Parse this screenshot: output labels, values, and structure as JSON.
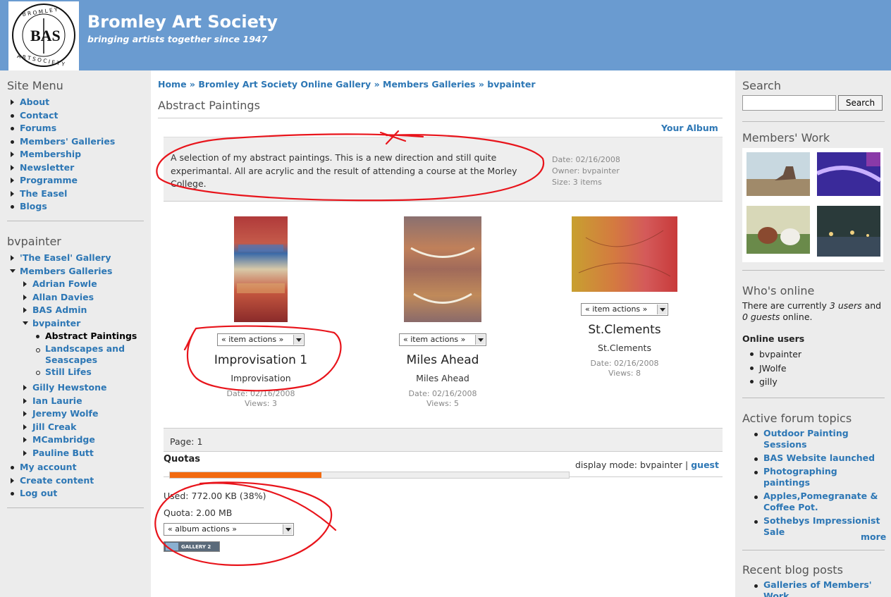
{
  "header": {
    "logo_text": "BAS",
    "logo_ring_text": "BROMLEY ART SOCIETY",
    "site_name": "Bromley Art Society",
    "slogan": "bringing artists together since 1947"
  },
  "site_menu": {
    "title": "Site Menu",
    "items": [
      "About",
      "Contact",
      "Forums",
      "Members' Galleries",
      "Membership",
      "Newsletter",
      "Programme",
      "The Easel",
      "Blogs"
    ]
  },
  "user_menu": {
    "title": "bvpainter",
    "easel_gallery": "'The Easel' Gallery",
    "members_galleries": "Members Galleries",
    "members": [
      "Adrian Fowle",
      "Allan Davies",
      "BAS Admin"
    ],
    "bvpainter": "bvpainter",
    "bvpainter_albums": [
      "Abstract Paintings",
      "Landscapes and",
      "Seascapes",
      "Still Lifes"
    ],
    "members_after": [
      "Gilly Hewstone",
      "Ian Laurie",
      "Jeremy Wolfe",
      "Jill Creak",
      "MCambridge",
      "Pauline Butt"
    ],
    "my_account": "My account",
    "create_content": "Create content",
    "log_out": "Log out"
  },
  "breadcrumb": [
    "Home",
    "Bromley Art Society Online Gallery",
    "Members Galleries",
    "bvpainter"
  ],
  "breadcrumb_sep": "»",
  "page_title": "Abstract Paintings",
  "your_album": "Your Album",
  "album": {
    "description": "A selection of my abstract paintings. This is a new direction and still quite experimantal. All are acrylic and the result of attending a course at the Morley College.",
    "date": "Date: 02/16/2008",
    "owner": "Owner: bvpainter",
    "size": "Size: 3 items"
  },
  "items": [
    {
      "title": "Improvisation 1",
      "summary": "Improvisation",
      "date": "Date: 02/16/2008",
      "views": "Views: 3",
      "actions": "« item actions »"
    },
    {
      "title": "Miles Ahead",
      "summary": "Miles Ahead",
      "date": "Date: 02/16/2008",
      "views": "Views: 5",
      "actions": "« item actions »"
    },
    {
      "title": "St.Clements",
      "summary": "St.Clements",
      "date": "Date: 02/16/2008",
      "views": "Views: 8",
      "actions": "« item actions »"
    }
  ],
  "pager": "Page:  1",
  "quotas": {
    "title": "Quotas",
    "display_mode_label": "display mode: bvpainter |",
    "guest_link": "guest",
    "used": "Used: 772.00 KB (38%)",
    "used_fraction": 0.38,
    "quota": "Quota: 2.00 MB",
    "album_actions": "« album actions »",
    "gallery_badge": "GALLERY 2"
  },
  "search": {
    "title": "Search",
    "value": "",
    "button": "Search"
  },
  "members_work": {
    "title": "Members' Work"
  },
  "whos_online": {
    "title": "Who's online",
    "text_pre": "There are currently ",
    "users": "3 users",
    "text_mid": " and",
    "guests": "0 guests",
    "text_post": " online.",
    "online_users_title": "Online users",
    "users_list": [
      "bvpainter",
      "JWolfe",
      "gilly"
    ]
  },
  "forum": {
    "title": "Active forum topics",
    "topics": [
      "Outdoor Painting",
      "Sessions",
      "BAS Website launched",
      "Photographing paintings",
      "Apples,Pomegranate &",
      "Coffee Pot.",
      "Sothebys Impressionist",
      "Sale"
    ],
    "more": "more"
  },
  "blog": {
    "title": "Recent blog posts",
    "posts": [
      "Galleries of Members'",
      "Work"
    ]
  },
  "colors": {
    "header": "#6a9bd0",
    "link": "#2d77b5",
    "quota_bar": "#f26a10",
    "annotation": "#e8141b"
  }
}
